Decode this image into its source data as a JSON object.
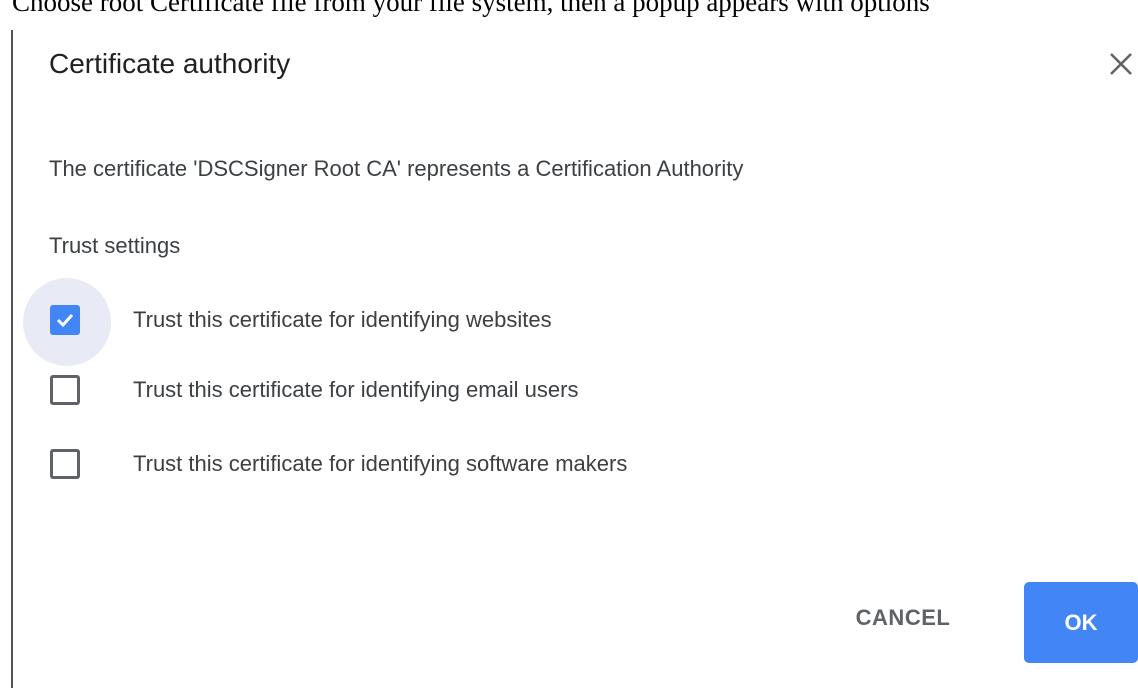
{
  "caption": "Choose root Certificate file from your file system, then a popup appears with options",
  "dialog": {
    "title": "Certificate authority",
    "close_icon": "close-icon",
    "description": "The certificate 'DSCSigner Root CA' represents a Certification Authority",
    "section_label": "Trust settings",
    "options": [
      {
        "label": "Trust this certificate for identifying websites",
        "checked": true
      },
      {
        "label": "Trust this certificate for identifying email users",
        "checked": false
      },
      {
        "label": "Trust this certificate for identifying software makers",
        "checked": false
      }
    ],
    "cancel_label": "CANCEL",
    "ok_label": "OK"
  },
  "colors": {
    "accent": "#4285f4",
    "focus_ring": "#e8eaf6",
    "text": "#3c4043",
    "title": "#202124",
    "checkbox_border": "#5f6368"
  }
}
